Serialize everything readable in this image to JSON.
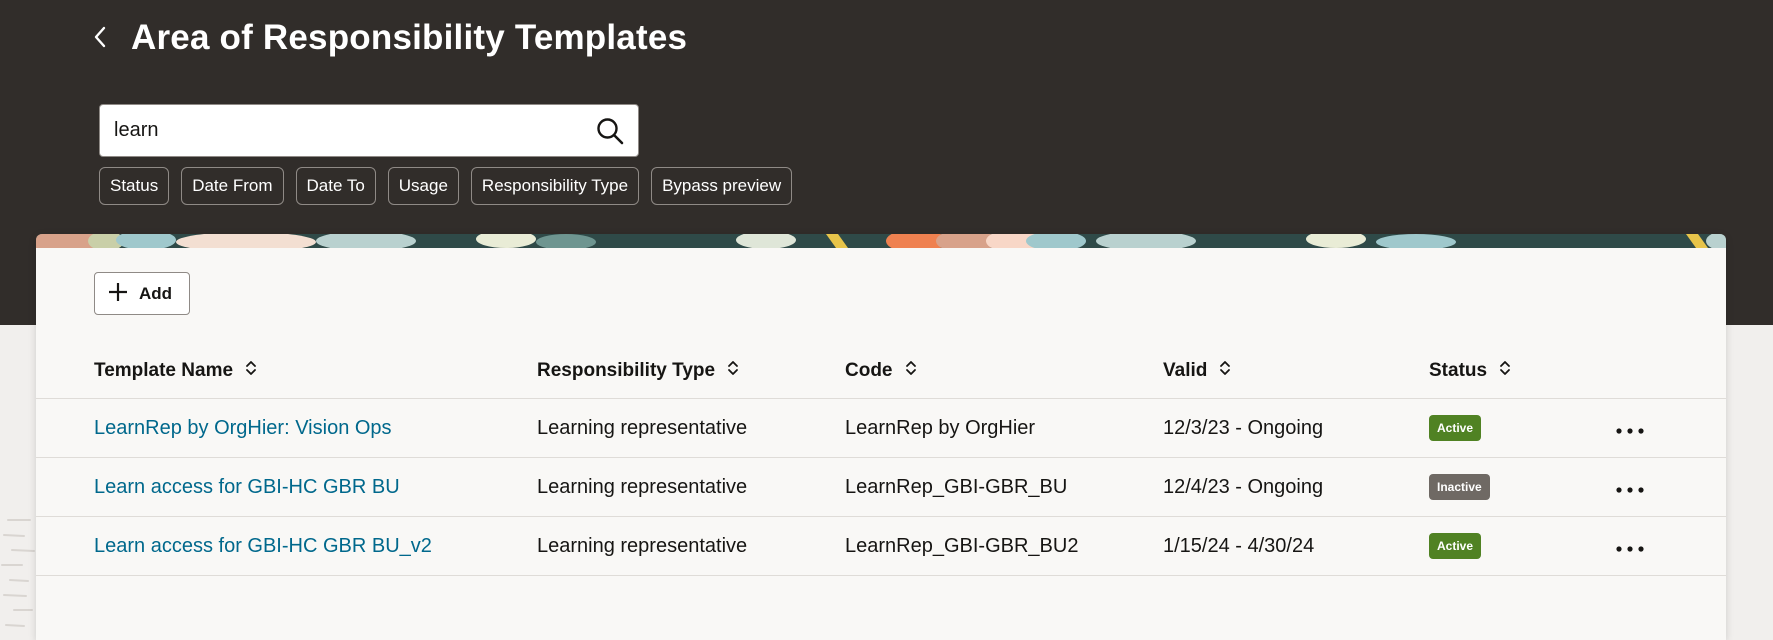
{
  "page": {
    "title": "Area of Responsibility Templates"
  },
  "search": {
    "value": "learn"
  },
  "filters": [
    "Status",
    "Date From",
    "Date To",
    "Usage",
    "Responsibility Type",
    "Bypass preview"
  ],
  "toolbar": {
    "add_label": "Add"
  },
  "table": {
    "columns": [
      "Template Name",
      "Responsibility Type",
      "Code",
      "Valid",
      "Status"
    ],
    "rows": [
      {
        "name": "LearnRep by OrgHier: Vision Ops",
        "type": "Learning representative",
        "code": "LearnRep by OrgHier",
        "valid": "12/3/23 - Ongoing",
        "status": "Active"
      },
      {
        "name": "Learn access for GBI-HC GBR BU",
        "type": "Learning representative",
        "code": "LearnRep_GBI-GBR_BU",
        "valid": "12/4/23 - Ongoing",
        "status": "Inactive"
      },
      {
        "name": "Learn access for GBI-HC GBR BU_v2",
        "type": "Learning representative",
        "code": "LearnRep_GBI-GBR_BU2",
        "valid": "1/15/24 - 4/30/24",
        "status": "Active"
      }
    ]
  },
  "colors": {
    "header_bg": "#312d2a",
    "link": "#00688c",
    "active_badge": "#508223",
    "inactive_badge": "#6f6964"
  },
  "icons": {
    "back": "chevron-left-icon",
    "search": "search-icon",
    "add": "plus-icon",
    "sort": "sort-icon",
    "more": "more-icon"
  }
}
